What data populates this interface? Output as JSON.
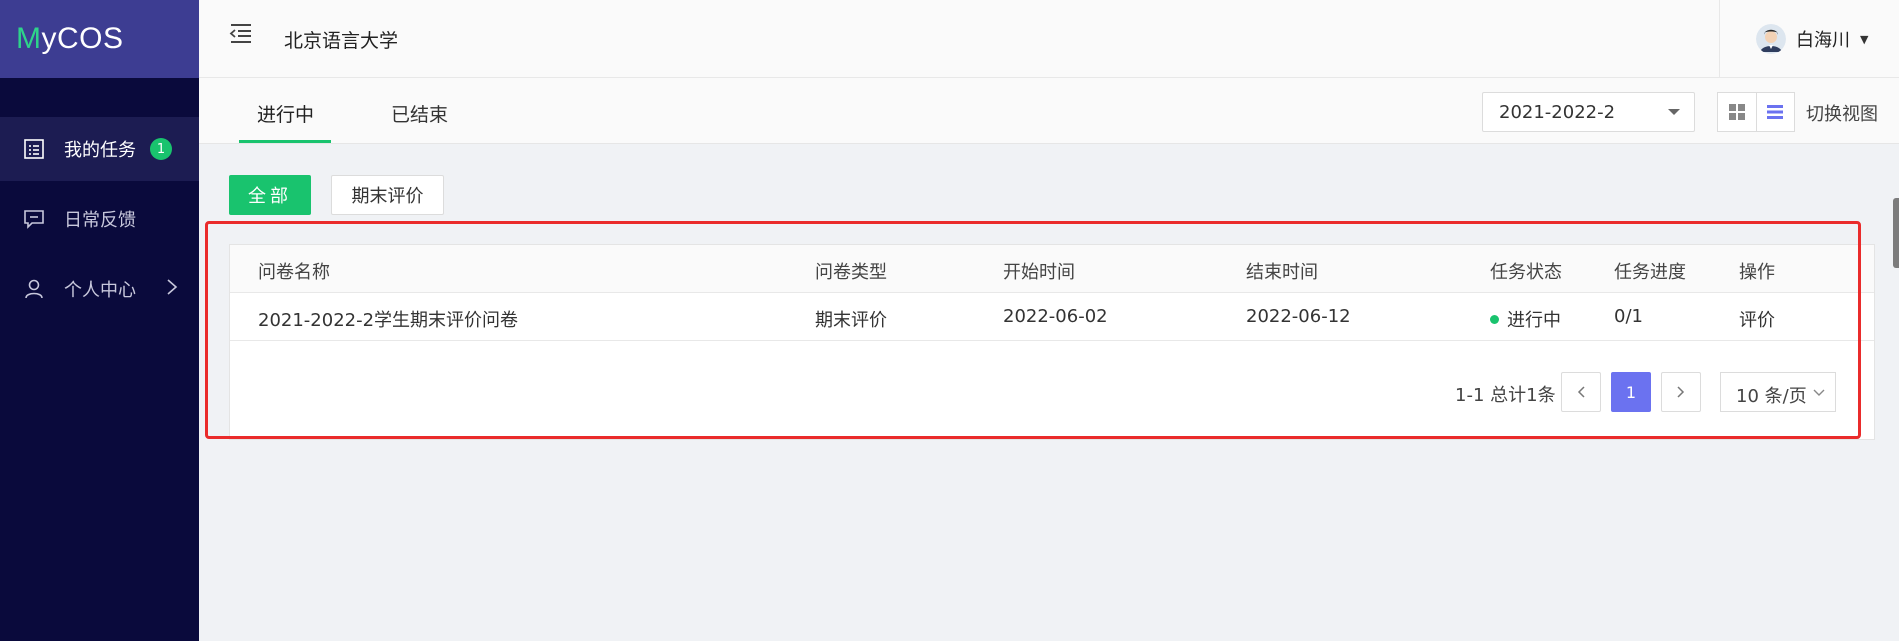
{
  "app": {
    "logo_first": "M",
    "logo_rest": "yCOS"
  },
  "sidebar": {
    "items": [
      {
        "label": "我的任务",
        "badge": "1",
        "icon": "task-list-icon"
      },
      {
        "label": "日常反馈",
        "icon": "feedback-icon"
      },
      {
        "label": "个人中心",
        "icon": "user-icon"
      }
    ]
  },
  "header": {
    "org": "北京语言大学",
    "user": "白海川"
  },
  "tabs": [
    {
      "label": "进行中"
    },
    {
      "label": "已结束"
    }
  ],
  "semester": {
    "value": "2021-2022-2"
  },
  "view": {
    "switch_label": "切换视图"
  },
  "filters": {
    "all": "全部",
    "final": "期末评价"
  },
  "table": {
    "columns": [
      "问卷名称",
      "问卷类型",
      "开始时间",
      "结束时间",
      "任务状态",
      "任务进度",
      "操作"
    ],
    "rows": [
      {
        "name": "2021-2022-2学生期末评价问卷",
        "type": "期末评价",
        "start": "2022-06-02",
        "end": "2022-06-12",
        "status": "进行中",
        "progress": "0/1",
        "action": "评价"
      }
    ]
  },
  "pagination": {
    "summary": "1-1 总计1条",
    "current": "1",
    "page_size": "10 条/页"
  },
  "colors": {
    "accent_green": "#19c36e",
    "sidebar_bg": "#0a0a3c",
    "logo_bg": "#3d3d92",
    "link": "#6b72f0",
    "highlight": "#ea2b2b"
  }
}
